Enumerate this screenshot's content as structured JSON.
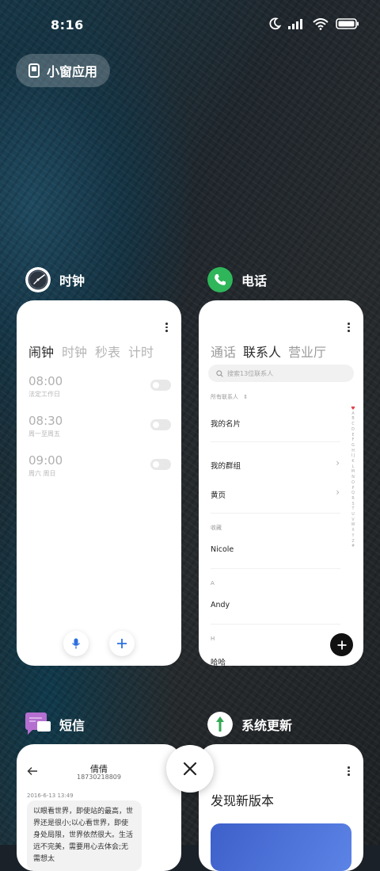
{
  "status_bar": {
    "time": "8:16"
  },
  "floating_window_button": {
    "label": "小窗应用"
  },
  "apps": {
    "clock": {
      "name": "时钟",
      "tabs": [
        "闹钟",
        "时钟",
        "秒表",
        "计时"
      ],
      "alarms": [
        {
          "time": "08:00",
          "repeat": "法定工作日"
        },
        {
          "time": "08:30",
          "repeat": "周一至周五"
        },
        {
          "time": "09:00",
          "repeat": "周六 周日"
        }
      ]
    },
    "phone": {
      "name": "电话",
      "tabs": [
        "通话",
        "联系人",
        "营业厅"
      ],
      "search_placeholder": "搜索13位联系人",
      "filter_label": "所有联系人",
      "my_card": "我的名片",
      "my_groups": "我的群组",
      "yellow_pages": "黄页",
      "section_favorites": "收藏",
      "contact_nicole": "Nicole",
      "section_a": "A",
      "contact_andy": "Andy",
      "section_h": "H",
      "contact_haha": "哈哈",
      "alphabet": "A B C D E F G H I J K L M N O P Q R S T U V W X Y Z #"
    },
    "sms": {
      "name": "短信",
      "contact_name": "倩倩",
      "contact_number": "18730218809",
      "date": "2016-6-13 13:49",
      "message": "以眼看世界，即使站的最高，世界还是很小;以心看世界，即使身处局限，世界依然很大。生活远不完美，需要用心去体会;无需想太"
    },
    "system_update": {
      "name": "系统更新",
      "title": "发现新版本"
    }
  },
  "colors": {
    "phone_green": "#2fb65a",
    "sms_purple": "#b56fd0",
    "update_green": "#34a853",
    "accent_blue": "#2a6fe0"
  }
}
